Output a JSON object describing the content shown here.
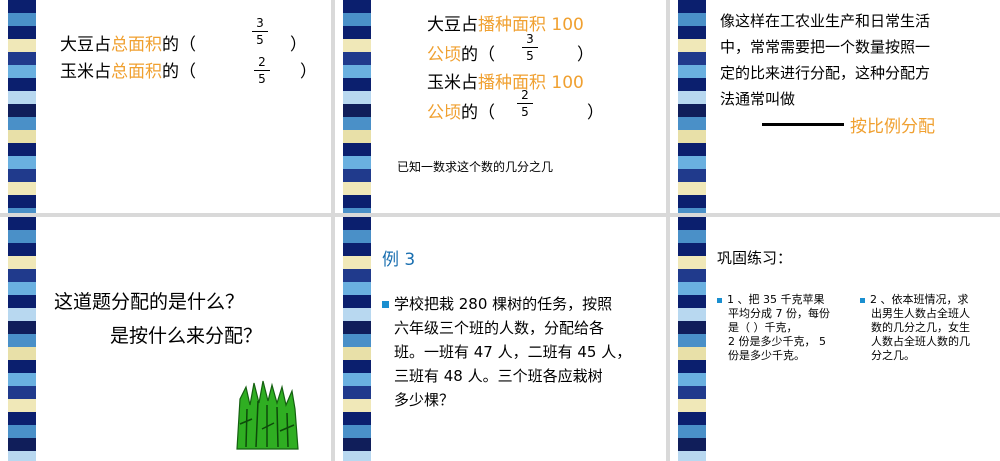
{
  "stripe_colors": [
    "#0b1f6e",
    "#4a90c8",
    "#0b1f6e",
    "#f0e8b8",
    "#203a8c",
    "#6ab0e0",
    "#0b1f6e",
    "#b8d8f0",
    "#101e5a",
    "#4a90c8",
    "#e8e0a8",
    "#0b1f6e",
    "#6ab0e0",
    "#203a8c",
    "#f0e8b8",
    "#0b1f6e",
    "#4a90c8",
    "#101e5a",
    "#b8d8f0",
    "#0b1f6e"
  ],
  "slide1": {
    "line1_a": "大豆占",
    "line1_b": "总面积",
    "line1_c": "的（",
    "line1_close": "）",
    "frac1_num": "3",
    "frac1_den": "5",
    "line2_a": "玉米占",
    "line2_b": "总面积",
    "line2_c": "的（",
    "line2_close": "）",
    "frac2_num": "2",
    "frac2_den": "5"
  },
  "slide2": {
    "l1a": "大豆占",
    "l1b": "播种面积 100",
    "l2a": "公顷",
    "l2b": "的（",
    "l2close": "）",
    "f1n": "3",
    "f1d": "5",
    "l3a": "玉米占",
    "l3b": "播种面积 100",
    "l4a": "公顷",
    "l4b": "的（",
    "l4close": "）",
    "f2n": "2",
    "f2d": "5",
    "note": "已知一数求这个数的几分之几"
  },
  "slide3": {
    "l1": "像这样在工农业生产和日常生活",
    "l2": "中，常常需要把一个数量按照一",
    "l3": "定的比来进行分配，这种分配方",
    "l4": "法通常叫做",
    "answer": "按比例分配"
  },
  "slide4": {
    "q1": "这道题分配的是什么？",
    "q2": "是按什么来分配？"
  },
  "slide5": {
    "title": "例 3",
    "l1": "学校把栽 280 棵树的任务，按照",
    "l2": "六年级三个班的人数，分配给各",
    "l3": "班。一班有 47 人，二班有 45 人，",
    "l4": "三班有 48 人。三个班各应栽树",
    "l5": "多少棵？"
  },
  "slide6": {
    "title": "巩固练习：",
    "ex1": [
      "1 、把 35 千克苹果",
      "平均分成 7 份，每份",
      "是（        ）千克，",
      "2 份是多少千克，  5",
      "份是多少千克。"
    ],
    "ex2": [
      "2 、依本班情况，求",
      "出男生人数占全班人",
      "数的几分之几，女生",
      "人数占全班人数的几",
      "分之几。"
    ]
  }
}
